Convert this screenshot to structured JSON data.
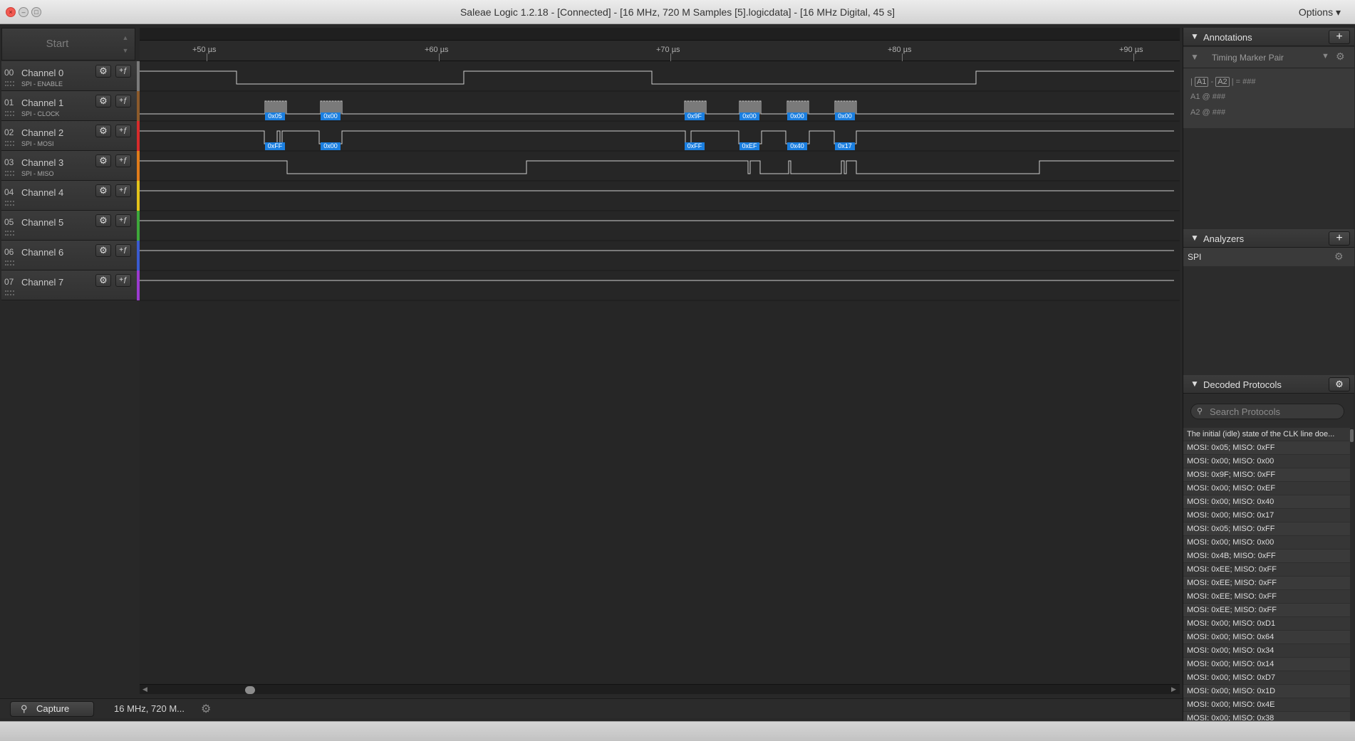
{
  "window": {
    "title": "Saleae Logic 1.2.18 - [Connected] - [16 MHz, 720 M Samples [5].logicdata] - [16 MHz Digital, 45 s]",
    "options_label": "Options ▾"
  },
  "start_button": {
    "label": "Start"
  },
  "channels": [
    {
      "num": "00",
      "name": "Channel 0",
      "sub": "SPI - ENABLE",
      "color": "#7a7a7a"
    },
    {
      "num": "01",
      "name": "Channel 1",
      "sub": "SPI - CLOCK",
      "color": "#8b5a2b"
    },
    {
      "num": "02",
      "name": "Channel 2",
      "sub": "SPI - MOSI",
      "color": "#d62b2b"
    },
    {
      "num": "03",
      "name": "Channel 3",
      "sub": "SPI - MISO",
      "color": "#e07b1a"
    },
    {
      "num": "04",
      "name": "Channel 4",
      "sub": "",
      "color": "#e3c21a"
    },
    {
      "num": "05",
      "name": "Channel 5",
      "sub": "",
      "color": "#3ea83a"
    },
    {
      "num": "06",
      "name": "Channel 6",
      "sub": "",
      "color": "#3a5bd0"
    },
    {
      "num": "07",
      "name": "Channel 7",
      "sub": "",
      "color": "#9b3ad0"
    }
  ],
  "ruler": {
    "labels": [
      "+50 µs",
      "+60 µs",
      "+70 µs",
      "+80 µs",
      "+90 µs"
    ]
  },
  "decodes": {
    "mosi": [
      "0x05",
      "0x00",
      "0x9F",
      "0x00",
      "0x00",
      "0x00"
    ],
    "miso": [
      "0xFF",
      "0x00",
      "0xFF",
      "0xEF",
      "0x40",
      "0x17"
    ]
  },
  "bottom": {
    "capture_label": "Capture",
    "sample_info": "16 MHz, 720 M..."
  },
  "panel": {
    "annotations_title": "Annotations",
    "marker_label": "Timing Marker Pair",
    "annot_line1": {
      "a1": "A1",
      "dash": "-",
      "a2": "A2",
      "eq": "= ###"
    },
    "annot_line2": "A1  @  ###",
    "annot_line3": "A2  @  ###",
    "analyzers_title": "Analyzers",
    "analyzer_item": "SPI",
    "decoded_title": "Decoded Protocols",
    "search_placeholder": "Search Protocols",
    "protocols": [
      "The initial (idle) state of the CLK line doe...",
      "MOSI: 0x05;  MISO: 0xFF",
      "MOSI: 0x00;  MISO: 0x00",
      "MOSI: 0x9F;  MISO: 0xFF",
      "MOSI: 0x00;  MISO: 0xEF",
      "MOSI: 0x00;  MISO: 0x40",
      "MOSI: 0x00;  MISO: 0x17",
      "MOSI: 0x05;  MISO: 0xFF",
      "MOSI: 0x00;  MISO: 0x00",
      "MOSI: 0x4B;  MISO: 0xFF",
      "MOSI: 0xEE;  MISO: 0xFF",
      "MOSI: 0xEE;  MISO: 0xFF",
      "MOSI: 0xEE;  MISO: 0xFF",
      "MOSI: 0xEE;  MISO: 0xFF",
      "MOSI: 0x00;  MISO: 0xD1",
      "MOSI: 0x00;  MISO: 0x64",
      "MOSI: 0x00;  MISO: 0x34",
      "MOSI: 0x00;  MISO: 0x14",
      "MOSI: 0x00;  MISO: 0xD7",
      "MOSI: 0x00;  MISO: 0x1D",
      "MOSI: 0x00;  MISO: 0x4E",
      "MOSI: 0x00;  MISO: 0x38"
    ]
  }
}
